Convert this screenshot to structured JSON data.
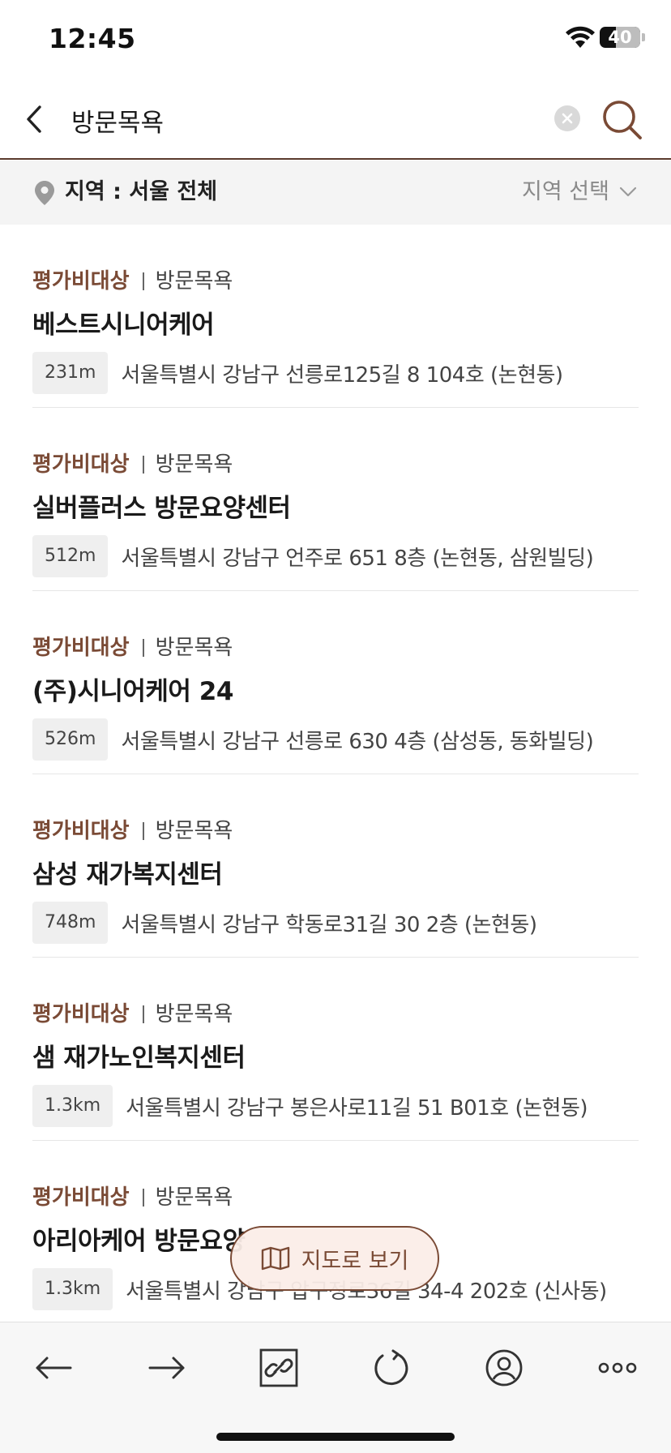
{
  "status_bar": {
    "time": "12:45",
    "battery_level": "40",
    "battery_fraction": 0.4
  },
  "search": {
    "query": "방문목욕",
    "placeholder": ""
  },
  "region": {
    "label": "지역 : 서울 전체",
    "select_label": "지역 선택"
  },
  "results": [
    {
      "grade": "평가비대상",
      "service": "방문목욕",
      "name": "베스트시니어케어",
      "distance": "231m",
      "address": "서울특별시 강남구 선릉로125길 8 104호 (논현동)"
    },
    {
      "grade": "평가비대상",
      "service": "방문목욕",
      "name": "실버플러스 방문요양센터",
      "distance": "512m",
      "address": "서울특별시 강남구 언주로 651 8층 (논현동, 삼원빌딩)"
    },
    {
      "grade": "평가비대상",
      "service": "방문목욕",
      "name": "(주)시니어케어 24",
      "distance": "526m",
      "address": "서울특별시 강남구 선릉로 630 4층 (삼성동, 동화빌딩)"
    },
    {
      "grade": "평가비대상",
      "service": "방문목욕",
      "name": "삼성 재가복지센터",
      "distance": "748m",
      "address": "서울특별시 강남구 학동로31길 30 2층 (논현동)"
    },
    {
      "grade": "평가비대상",
      "service": "방문목욕",
      "name": "샘 재가노인복지센터",
      "distance": "1.3km",
      "address": "서울특별시 강남구 봉은사로11길 51 B01호 (논현동)"
    },
    {
      "grade": "평가비대상",
      "service": "방문목욕",
      "name": "아리아케어 방문요양",
      "distance": "1.3km",
      "address": "서울특별시 강남구 압구정로36길 34-4 202호 (신사동)"
    }
  ],
  "map_button": {
    "label": "지도로 보기"
  },
  "toolbar": {
    "items": [
      "back-arrow-icon",
      "forward-arrow-icon",
      "link-icon",
      "refresh-icon",
      "profile-icon",
      "more-icon"
    ]
  },
  "colors": {
    "accent": "#7a4a35",
    "divider": "#5a3a2c",
    "region_bg": "#f4f4f4",
    "distance_bg": "#efefef"
  }
}
